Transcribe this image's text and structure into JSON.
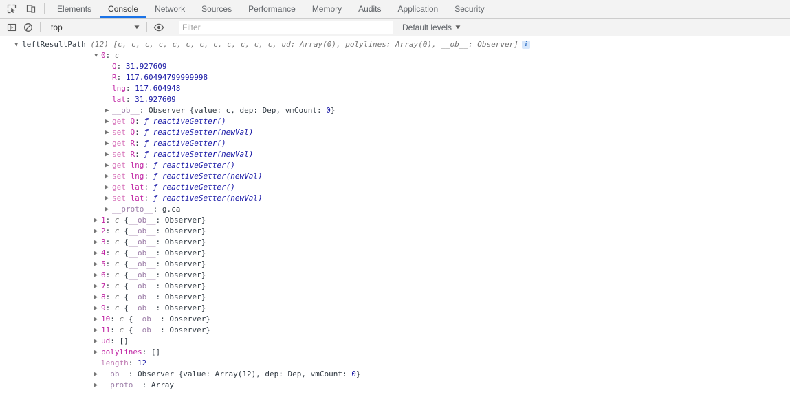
{
  "tabbar": {
    "icons": [
      {
        "name": "inspect-element-icon",
        "label": "Inspect element"
      },
      {
        "name": "device-toolbar-icon",
        "label": "Toggle device toolbar"
      }
    ],
    "tabs": [
      {
        "label": "Elements",
        "active": false
      },
      {
        "label": "Console",
        "active": true
      },
      {
        "label": "Network",
        "active": false
      },
      {
        "label": "Sources",
        "active": false
      },
      {
        "label": "Performance",
        "active": false
      },
      {
        "label": "Memory",
        "active": false
      },
      {
        "label": "Audits",
        "active": false
      },
      {
        "label": "Application",
        "active": false
      },
      {
        "label": "Security",
        "active": false
      }
    ],
    "active_tab_accent": "#1a73e8"
  },
  "filterbar": {
    "sidebar_toggle_icon": "console-sidebar-icon",
    "clear_console_icon": "clear-console-icon",
    "context_value": "top",
    "context_caret": "▼",
    "eye_icon": "live-expression-eye-icon",
    "filter_placeholder": "Filter",
    "filter_value": "",
    "levels_label": "Default levels",
    "levels_caret": "▼"
  },
  "console": {
    "source_label": "leftResultPath",
    "info_badge_text": "i",
    "rows": [
      {
        "indent": 0,
        "arrow": "open",
        "segments": [
          {
            "text": "leftResultPath",
            "cls": "k-label"
          },
          {
            "text": " ",
            "cls": "k-plain"
          },
          {
            "text": "(12) [c, c, c, c, c, c, c, c, c, c, c, c, ud: Array(0), polylines: Array(0), __ob__: Observer]",
            "cls": "k-preview"
          }
        ]
      },
      {
        "indent": 1,
        "arrow": "open",
        "segments": [
          {
            "text": "0",
            "cls": "k-prop"
          },
          {
            "text": ": ",
            "cls": "k-plain"
          },
          {
            "text": "c",
            "cls": "k-ctor"
          }
        ]
      },
      {
        "indent": 2,
        "arrow": "none",
        "segments": [
          {
            "text": "Q",
            "cls": "k-prop"
          },
          {
            "text": ": ",
            "cls": "k-plain"
          },
          {
            "text": "31.927609",
            "cls": "k-num"
          }
        ]
      },
      {
        "indent": 2,
        "arrow": "none",
        "segments": [
          {
            "text": "R",
            "cls": "k-prop"
          },
          {
            "text": ": ",
            "cls": "k-plain"
          },
          {
            "text": "117.60494799999998",
            "cls": "k-num"
          }
        ]
      },
      {
        "indent": 2,
        "arrow": "none",
        "segments": [
          {
            "text": "lng",
            "cls": "k-prop"
          },
          {
            "text": ": ",
            "cls": "k-plain"
          },
          {
            "text": "117.604948",
            "cls": "k-num"
          }
        ]
      },
      {
        "indent": 2,
        "arrow": "none",
        "segments": [
          {
            "text": "lat",
            "cls": "k-prop"
          },
          {
            "text": ": ",
            "cls": "k-plain"
          },
          {
            "text": "31.927609",
            "cls": "k-num"
          }
        ]
      },
      {
        "indent": 2,
        "arrow": "closed",
        "segments": [
          {
            "text": "__ob__",
            "cls": "k-internal"
          },
          {
            "text": ": ",
            "cls": "k-plain"
          },
          {
            "text": "Observer {value: c, dep: Dep, vmCount: ",
            "cls": "k-obj"
          },
          {
            "text": "0",
            "cls": "k-num"
          },
          {
            "text": "}",
            "cls": "k-obj"
          }
        ]
      },
      {
        "indent": 2,
        "arrow": "closed",
        "segments": [
          {
            "text": "get ",
            "cls": "k-kw"
          },
          {
            "text": "Q",
            "cls": "k-prop"
          },
          {
            "text": ": ",
            "cls": "k-plain"
          },
          {
            "text": "ƒ reactiveGetter()",
            "cls": "k-fn"
          }
        ]
      },
      {
        "indent": 2,
        "arrow": "closed",
        "segments": [
          {
            "text": "set ",
            "cls": "k-kw"
          },
          {
            "text": "Q",
            "cls": "k-prop"
          },
          {
            "text": ": ",
            "cls": "k-plain"
          },
          {
            "text": "ƒ reactiveSetter(newVal)",
            "cls": "k-fn"
          }
        ]
      },
      {
        "indent": 2,
        "arrow": "closed",
        "segments": [
          {
            "text": "get ",
            "cls": "k-kw"
          },
          {
            "text": "R",
            "cls": "k-prop"
          },
          {
            "text": ": ",
            "cls": "k-plain"
          },
          {
            "text": "ƒ reactiveGetter()",
            "cls": "k-fn"
          }
        ]
      },
      {
        "indent": 2,
        "arrow": "closed",
        "segments": [
          {
            "text": "set ",
            "cls": "k-kw"
          },
          {
            "text": "R",
            "cls": "k-prop"
          },
          {
            "text": ": ",
            "cls": "k-plain"
          },
          {
            "text": "ƒ reactiveSetter(newVal)",
            "cls": "k-fn"
          }
        ]
      },
      {
        "indent": 2,
        "arrow": "closed",
        "segments": [
          {
            "text": "get ",
            "cls": "k-kw"
          },
          {
            "text": "lng",
            "cls": "k-prop"
          },
          {
            "text": ": ",
            "cls": "k-plain"
          },
          {
            "text": "ƒ reactiveGetter()",
            "cls": "k-fn"
          }
        ]
      },
      {
        "indent": 2,
        "arrow": "closed",
        "segments": [
          {
            "text": "set ",
            "cls": "k-kw"
          },
          {
            "text": "lng",
            "cls": "k-prop"
          },
          {
            "text": ": ",
            "cls": "k-plain"
          },
          {
            "text": "ƒ reactiveSetter(newVal)",
            "cls": "k-fn"
          }
        ]
      },
      {
        "indent": 2,
        "arrow": "closed",
        "segments": [
          {
            "text": "get ",
            "cls": "k-kw"
          },
          {
            "text": "lat",
            "cls": "k-prop"
          },
          {
            "text": ": ",
            "cls": "k-plain"
          },
          {
            "text": "ƒ reactiveGetter()",
            "cls": "k-fn"
          }
        ]
      },
      {
        "indent": 2,
        "arrow": "closed",
        "segments": [
          {
            "text": "set ",
            "cls": "k-kw"
          },
          {
            "text": "lat",
            "cls": "k-prop"
          },
          {
            "text": ": ",
            "cls": "k-plain"
          },
          {
            "text": "ƒ reactiveSetter(newVal)",
            "cls": "k-fn"
          }
        ]
      },
      {
        "indent": 2,
        "arrow": "closed",
        "segments": [
          {
            "text": "__proto__",
            "cls": "k-internal"
          },
          {
            "text": ": ",
            "cls": "k-plain"
          },
          {
            "text": "g.ca",
            "cls": "k-obj"
          }
        ]
      },
      {
        "indent": 1,
        "arrow": "closed",
        "segments": [
          {
            "text": "1",
            "cls": "k-prop"
          },
          {
            "text": ": ",
            "cls": "k-plain"
          },
          {
            "text": "c",
            "cls": "k-ctor"
          },
          {
            "text": " {",
            "cls": "k-obj"
          },
          {
            "text": "__ob__",
            "cls": "k-internal"
          },
          {
            "text": ": Observer}",
            "cls": "k-obj"
          }
        ]
      },
      {
        "indent": 1,
        "arrow": "closed",
        "segments": [
          {
            "text": "2",
            "cls": "k-prop"
          },
          {
            "text": ": ",
            "cls": "k-plain"
          },
          {
            "text": "c",
            "cls": "k-ctor"
          },
          {
            "text": " {",
            "cls": "k-obj"
          },
          {
            "text": "__ob__",
            "cls": "k-internal"
          },
          {
            "text": ": Observer}",
            "cls": "k-obj"
          }
        ]
      },
      {
        "indent": 1,
        "arrow": "closed",
        "segments": [
          {
            "text": "3",
            "cls": "k-prop"
          },
          {
            "text": ": ",
            "cls": "k-plain"
          },
          {
            "text": "c",
            "cls": "k-ctor"
          },
          {
            "text": " {",
            "cls": "k-obj"
          },
          {
            "text": "__ob__",
            "cls": "k-internal"
          },
          {
            "text": ": Observer}",
            "cls": "k-obj"
          }
        ]
      },
      {
        "indent": 1,
        "arrow": "closed",
        "segments": [
          {
            "text": "4",
            "cls": "k-prop"
          },
          {
            "text": ": ",
            "cls": "k-plain"
          },
          {
            "text": "c",
            "cls": "k-ctor"
          },
          {
            "text": " {",
            "cls": "k-obj"
          },
          {
            "text": "__ob__",
            "cls": "k-internal"
          },
          {
            "text": ": Observer}",
            "cls": "k-obj"
          }
        ]
      },
      {
        "indent": 1,
        "arrow": "closed",
        "segments": [
          {
            "text": "5",
            "cls": "k-prop"
          },
          {
            "text": ": ",
            "cls": "k-plain"
          },
          {
            "text": "c",
            "cls": "k-ctor"
          },
          {
            "text": " {",
            "cls": "k-obj"
          },
          {
            "text": "__ob__",
            "cls": "k-internal"
          },
          {
            "text": ": Observer}",
            "cls": "k-obj"
          }
        ]
      },
      {
        "indent": 1,
        "arrow": "closed",
        "segments": [
          {
            "text": "6",
            "cls": "k-prop"
          },
          {
            "text": ": ",
            "cls": "k-plain"
          },
          {
            "text": "c",
            "cls": "k-ctor"
          },
          {
            "text": " {",
            "cls": "k-obj"
          },
          {
            "text": "__ob__",
            "cls": "k-internal"
          },
          {
            "text": ": Observer}",
            "cls": "k-obj"
          }
        ]
      },
      {
        "indent": 1,
        "arrow": "closed",
        "segments": [
          {
            "text": "7",
            "cls": "k-prop"
          },
          {
            "text": ": ",
            "cls": "k-plain"
          },
          {
            "text": "c",
            "cls": "k-ctor"
          },
          {
            "text": " {",
            "cls": "k-obj"
          },
          {
            "text": "__ob__",
            "cls": "k-internal"
          },
          {
            "text": ": Observer}",
            "cls": "k-obj"
          }
        ]
      },
      {
        "indent": 1,
        "arrow": "closed",
        "segments": [
          {
            "text": "8",
            "cls": "k-prop"
          },
          {
            "text": ": ",
            "cls": "k-plain"
          },
          {
            "text": "c",
            "cls": "k-ctor"
          },
          {
            "text": " {",
            "cls": "k-obj"
          },
          {
            "text": "__ob__",
            "cls": "k-internal"
          },
          {
            "text": ": Observer}",
            "cls": "k-obj"
          }
        ]
      },
      {
        "indent": 1,
        "arrow": "closed",
        "segments": [
          {
            "text": "9",
            "cls": "k-prop"
          },
          {
            "text": ": ",
            "cls": "k-plain"
          },
          {
            "text": "c",
            "cls": "k-ctor"
          },
          {
            "text": " {",
            "cls": "k-obj"
          },
          {
            "text": "__ob__",
            "cls": "k-internal"
          },
          {
            "text": ": Observer}",
            "cls": "k-obj"
          }
        ]
      },
      {
        "indent": 1,
        "arrow": "closed",
        "segments": [
          {
            "text": "10",
            "cls": "k-prop"
          },
          {
            "text": ": ",
            "cls": "k-plain"
          },
          {
            "text": "c",
            "cls": "k-ctor"
          },
          {
            "text": " {",
            "cls": "k-obj"
          },
          {
            "text": "__ob__",
            "cls": "k-internal"
          },
          {
            "text": ": Observer}",
            "cls": "k-obj"
          }
        ]
      },
      {
        "indent": 1,
        "arrow": "closed",
        "segments": [
          {
            "text": "11",
            "cls": "k-prop"
          },
          {
            "text": ": ",
            "cls": "k-plain"
          },
          {
            "text": "c",
            "cls": "k-ctor"
          },
          {
            "text": " {",
            "cls": "k-obj"
          },
          {
            "text": "__ob__",
            "cls": "k-internal"
          },
          {
            "text": ": Observer}",
            "cls": "k-obj"
          }
        ]
      },
      {
        "indent": 1,
        "arrow": "closed",
        "segments": [
          {
            "text": "ud",
            "cls": "k-prop"
          },
          {
            "text": ": []",
            "cls": "k-obj"
          }
        ]
      },
      {
        "indent": 1,
        "arrow": "closed",
        "segments": [
          {
            "text": "polylines",
            "cls": "k-prop"
          },
          {
            "text": ": []",
            "cls": "k-obj"
          }
        ]
      },
      {
        "indent": 1,
        "arrow": "none",
        "segments": [
          {
            "text": "length",
            "cls": "k-proplite"
          },
          {
            "text": ": ",
            "cls": "k-plain"
          },
          {
            "text": "12",
            "cls": "k-num"
          }
        ]
      },
      {
        "indent": 1,
        "arrow": "closed",
        "segments": [
          {
            "text": "__ob__",
            "cls": "k-internal"
          },
          {
            "text": ": ",
            "cls": "k-plain"
          },
          {
            "text": "Observer {value: Array(12), dep: Dep, vmCount: ",
            "cls": "k-obj"
          },
          {
            "text": "0",
            "cls": "k-num"
          },
          {
            "text": "}",
            "cls": "k-obj"
          }
        ]
      },
      {
        "indent": 1,
        "arrow": "closed",
        "segments": [
          {
            "text": "__proto__",
            "cls": "k-internal"
          },
          {
            "text": ": ",
            "cls": "k-plain"
          },
          {
            "text": "Array",
            "cls": "k-obj"
          }
        ]
      }
    ]
  }
}
